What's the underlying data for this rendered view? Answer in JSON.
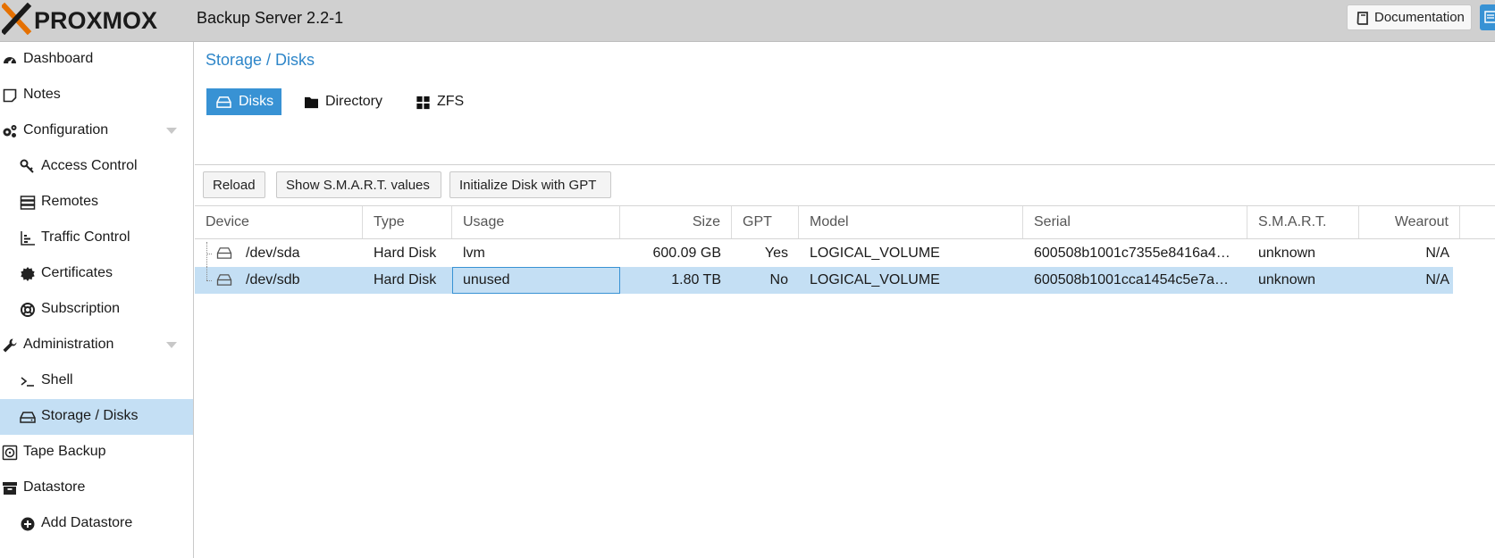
{
  "header": {
    "brand": "PROXMOX",
    "title": "Backup Server 2.2-1",
    "documentation_label": "Documentation"
  },
  "sidebar": {
    "items": [
      {
        "label": "Dashboard",
        "icon": "dashboard-icon"
      },
      {
        "label": "Notes",
        "icon": "notes-icon"
      },
      {
        "label": "Configuration",
        "icon": "cogs-icon"
      },
      {
        "label": "Access Control",
        "icon": "key-icon"
      },
      {
        "label": "Remotes",
        "icon": "server-icon"
      },
      {
        "label": "Traffic Control",
        "icon": "chart-icon"
      },
      {
        "label": "Certificates",
        "icon": "certificate-icon"
      },
      {
        "label": "Subscription",
        "icon": "lifebuoy-icon"
      },
      {
        "label": "Administration",
        "icon": "wrench-icon"
      },
      {
        "label": "Shell",
        "icon": "terminal-icon"
      },
      {
        "label": "Storage / Disks",
        "icon": "hdd-icon"
      },
      {
        "label": "Tape Backup",
        "icon": "tape-icon"
      },
      {
        "label": "Datastore",
        "icon": "archive-icon"
      },
      {
        "label": "Add Datastore",
        "icon": "plus-circle-icon"
      }
    ]
  },
  "main": {
    "breadcrumb": "Storage / Disks",
    "tabs": [
      {
        "label": "Disks",
        "active": true
      },
      {
        "label": "Directory",
        "active": false
      },
      {
        "label": "ZFS",
        "active": false
      }
    ],
    "toolbar": {
      "reload": "Reload",
      "smart": "Show S.M.A.R.T. values",
      "init_gpt": "Initialize Disk with GPT"
    },
    "columns": [
      "Device",
      "Type",
      "Usage",
      "Size",
      "GPT",
      "Model",
      "Serial",
      "S.M.A.R.T.",
      "Wearout"
    ],
    "rows": [
      {
        "device": "/dev/sda",
        "type": "Hard Disk",
        "usage": "lvm",
        "size": "600.09 GB",
        "gpt": "Yes",
        "model": "LOGICAL_VOLUME",
        "serial": "600508b1001c7355e8416a4…",
        "smart": "unknown",
        "wearout": "N/A"
      },
      {
        "device": "/dev/sdb",
        "type": "Hard Disk",
        "usage": "unused",
        "size": "1.80 TB",
        "gpt": "No",
        "model": "LOGICAL_VOLUME",
        "serial": "600508b1001cca1454c5e7a…",
        "smart": "unknown",
        "wearout": "N/A"
      }
    ]
  },
  "colors": {
    "accent": "#3892d4",
    "selection": "#c4dff4",
    "header_bg": "#d0d0d0",
    "logo_orange": "#e57000"
  }
}
